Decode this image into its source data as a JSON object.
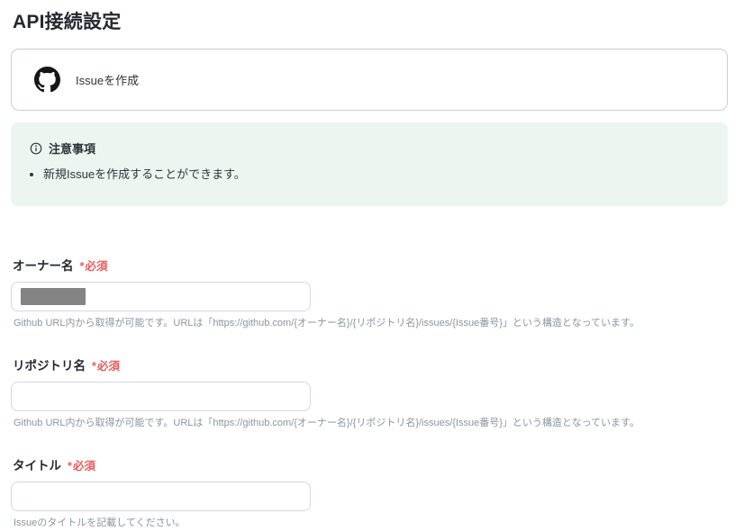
{
  "page": {
    "title": "API接続設定"
  },
  "action_card": {
    "icon": "github-icon",
    "label": "Issueを作成"
  },
  "notice": {
    "icon": "info-icon",
    "title": "注意事項",
    "items": [
      "新規Issueを作成することができます。"
    ]
  },
  "fields": [
    {
      "label": "オーナー名",
      "required_asterisk": "*",
      "required_label": "必須",
      "value_masked": true,
      "helper": "Github URL内から取得が可能です。URLは「https://github.com/{オーナー名}/{リポジトリ名}/issues/{Issue番号}」という構造となっています。"
    },
    {
      "label": "リポジトリ名",
      "required_asterisk": "*",
      "required_label": "必須",
      "value_masked": true,
      "helper": "Github URL内から取得が可能です。URLは「https://github.com/{オーナー名}/{リポジトリ名}/issues/{Issue番号}」という構造となっています。"
    },
    {
      "label": "タイトル",
      "required_asterisk": "*",
      "required_label": "必須",
      "value_masked": true,
      "helper": "Issueのタイトルを記載してください。"
    }
  ],
  "colors": {
    "required_red": "#ee5b5b",
    "notice_background": "#edf5f1",
    "masked_gray": "#848484",
    "helper_gray": "#8b95a1",
    "border_gray": "#c9ced3",
    "input_border": "#d4d9de",
    "text_dark": "#2f3437"
  }
}
